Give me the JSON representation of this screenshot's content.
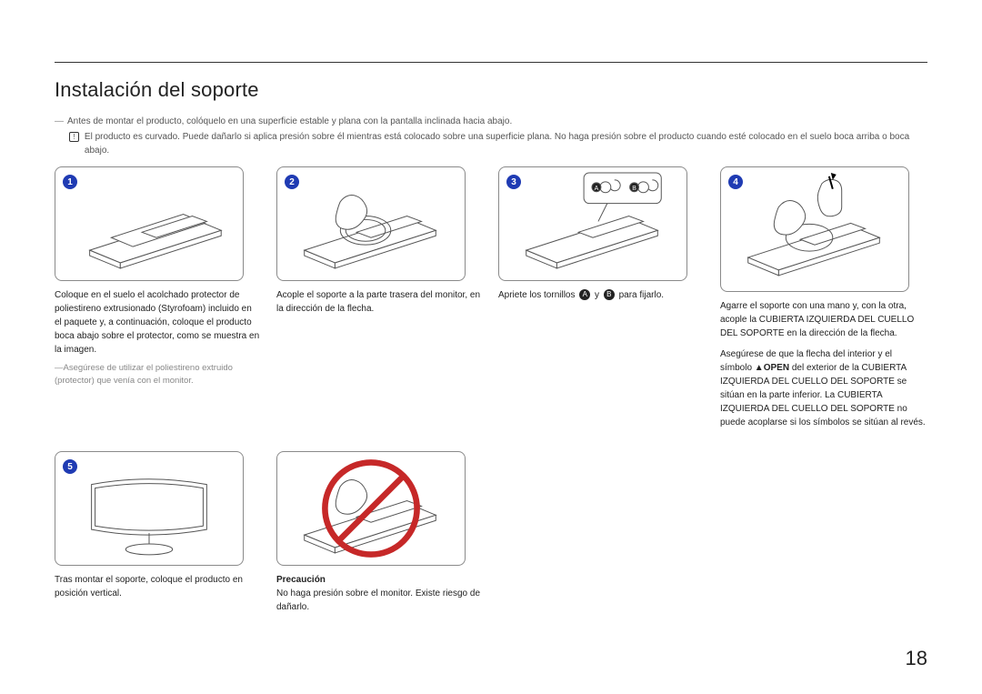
{
  "title": "Instalación del soporte",
  "intro_line": "Antes de montar el producto, colóquelo en una superficie estable y plana con la pantalla inclinada hacia abajo.",
  "warning_line": "El producto es curvado. Puede dañarlo si aplica presión sobre él mientras está colocado sobre una superficie plana. No haga presión sobre el producto cuando esté colocado en el suelo boca arriba o boca abajo.",
  "dash": "―",
  "warn_glyph": "!",
  "steps": {
    "s1": {
      "num": "1",
      "text": "Coloque en el suelo el acolchado protector de poliestireno extrusionado (Styrofoam) incluido en el paquete y, a continuación, coloque el producto boca abajo sobre el protector, como se muestra en la imagen.",
      "note": "Asegúrese de utilizar el poliestireno extruido (protector) que venía con el monitor."
    },
    "s2": {
      "num": "2",
      "text": "Acople el soporte a la parte trasera del monitor, en la dirección de la flecha."
    },
    "s3": {
      "num": "3",
      "text_a": "Apriete los tornillos ",
      "a": "A",
      "text_b": " y ",
      "b": "B",
      "text_c": " para fijarlo."
    },
    "s4": {
      "num": "4",
      "p1": "Agarre el soporte con una mano y, con la otra, acople la CUBIERTA IZQUIERDA DEL CUELLO DEL SOPORTE en la dirección de la flecha.",
      "p2_a": "Asegúrese de que la flecha del interior y el símbolo ",
      "open": "▲OPEN",
      "p2_b": " del exterior de la CUBIERTA IZQUIERDA DEL CUELLO DEL SOPORTE se sitúan en la parte inferior. La CUBIERTA IZQUIERDA DEL CUELLO DEL SOPORTE no puede acoplarse si los símbolos se sitúan al revés."
    },
    "s5": {
      "num": "5",
      "text": "Tras montar el soporte, coloque el producto en posición vertical."
    },
    "s6": {
      "title": "Precaución",
      "text": "No haga presión sobre el monitor. Existe riesgo de dañarlo."
    }
  },
  "page_number": "18"
}
